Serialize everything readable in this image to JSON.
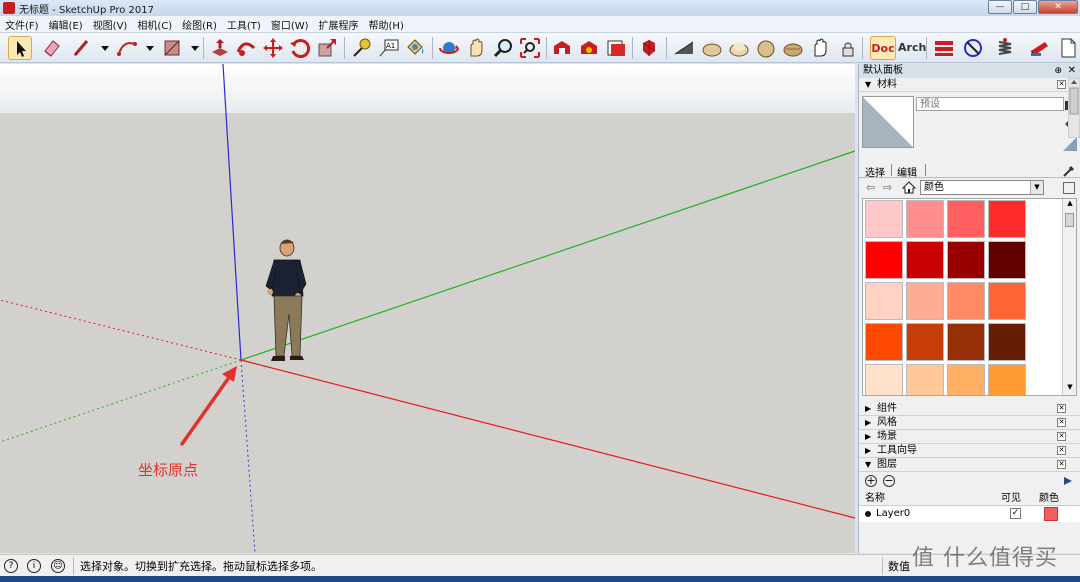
{
  "window": {
    "title": "无标题 - SketchUp Pro 2017",
    "controls": {
      "minimize": "—",
      "maximize": "□",
      "close": "✕"
    }
  },
  "menu": [
    "文件(F)",
    "编辑(E)",
    "视图(V)",
    "相机(C)",
    "绘图(R)",
    "工具(T)",
    "窗口(W)",
    "扩展程序",
    "帮助(H)"
  ],
  "toolbar": {
    "tools": [
      "select-tool-icon",
      "eraser-tool-icon",
      "line-tool-icon",
      "arc-tool-icon",
      "rectangle-tool-icon",
      "push-pull-icon",
      "follow-me-icon",
      "move-icon",
      "rotate-icon",
      "scale-icon",
      "tape-measure-icon",
      "text-icon",
      "paint-bucket-icon",
      "orbit-icon",
      "pan-icon",
      "zoom-icon",
      "zoom-extents-icon",
      "warehouse-icon",
      "extension-warehouse-icon",
      "layout-icon",
      "ruby-icon",
      "xray-icon",
      "wireframe-style-icon",
      "hidden-line-icon",
      "shaded-icon",
      "textured-icon",
      "hand-icon",
      "lock-icon",
      "doc-icon",
      "arch-icon",
      "section-icon",
      "xray-circle-icon",
      "spring-icon",
      "book-icon",
      "page-icon"
    ],
    "doc_label": "Doc",
    "arch_label": "Arch"
  },
  "viewport": {
    "annotation": "坐标原点",
    "colors": {
      "red_axis": "#e31c1c",
      "green_axis": "#22b022",
      "blue_axis": "#2b2bd6",
      "ground": "#d3d1cd",
      "sky": "#ffffff",
      "arrow": "#e0312b"
    }
  },
  "panel": {
    "title": "默认面板",
    "pin": "⊕",
    "close": "✕",
    "materials": {
      "header": "材料",
      "name_placeholder": "预设",
      "tabs": [
        "选择",
        "编辑"
      ],
      "library": "颜色",
      "swatches": [
        "#ffc8c8",
        "#ff8e8e",
        "#ff5f5f",
        "#ff2b2b",
        "#ff0000",
        "#c80000",
        "#9b0000",
        "#640000",
        "#ffd2c3",
        "#ffac94",
        "#ff8a64",
        "#ff6434",
        "#ff4800",
        "#c83c0a",
        "#962e08",
        "#641e05",
        "#ffe0c8",
        "#ffc896",
        "#ffb064",
        "#ff9b32"
      ]
    },
    "sections": [
      "组件",
      "风格",
      "场景",
      "工具向导",
      "图层"
    ],
    "layers": {
      "columns": [
        "名称",
        "可见",
        "颜色"
      ],
      "rows": [
        {
          "name": "Layer0",
          "visible": "✓",
          "color": "#f55e5e"
        }
      ]
    }
  },
  "status": {
    "message": "选择对象。切换到扩充选择。拖动鼠标选择多项。",
    "value_label": "数值",
    "icons": [
      "help-icon",
      "info-icon",
      "user-icon"
    ]
  },
  "watermark": "值 什么值得买"
}
